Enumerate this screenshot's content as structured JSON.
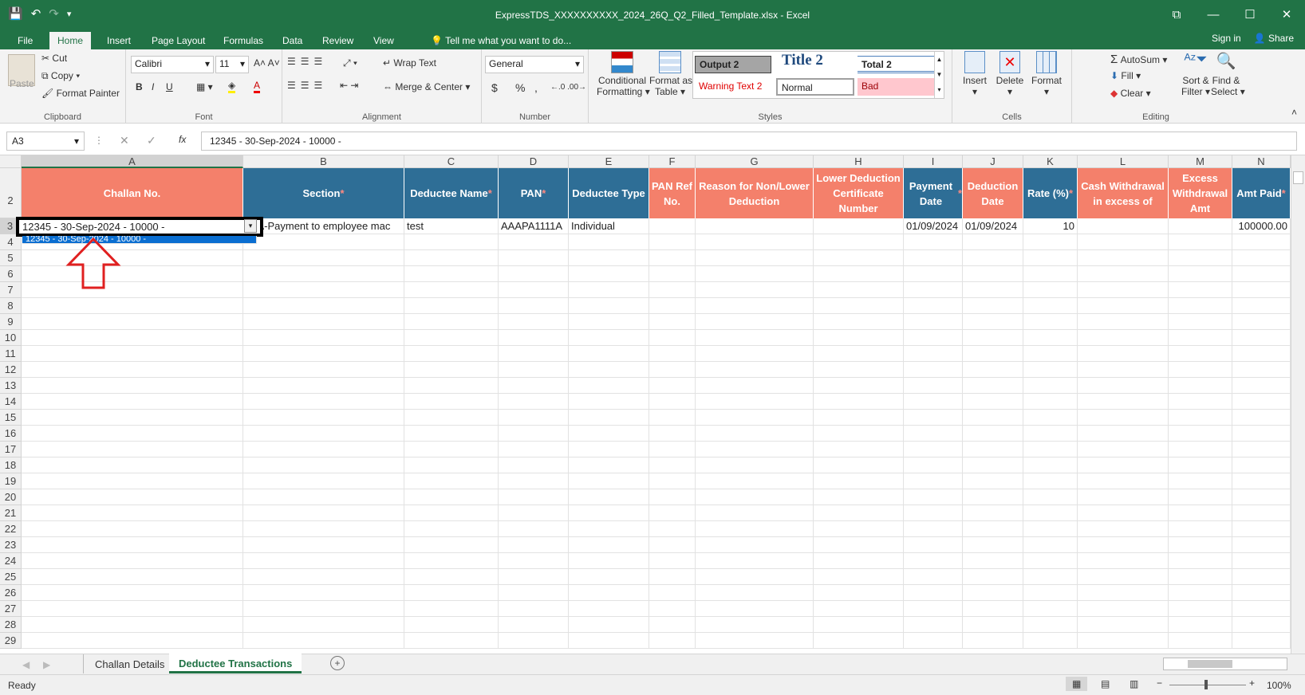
{
  "window": {
    "title": "ExpressTDS_XXXXXXXXXX_2024_26Q_Q2_Filled_Template.xlsx - Excel",
    "qat": {
      "save": "💾",
      "undo": "↶",
      "redo": "↷",
      "more": "▾"
    },
    "buttons": {
      "ribbon_display": "⧉",
      "minimize": "—",
      "maximize": "☐",
      "close": "✕"
    }
  },
  "menu": {
    "tabs": [
      "File",
      "Home",
      "Insert",
      "Page Layout",
      "Formulas",
      "Data",
      "Review",
      "View"
    ],
    "tell_me": "Tell me what you want to do...",
    "sign_in": "Sign in",
    "share": "Share"
  },
  "ribbon": {
    "clipboard": {
      "paste": "Paste",
      "cut": "Cut",
      "copy": "Copy",
      "format_painter": "Format Painter",
      "label": "Clipboard"
    },
    "font": {
      "name": "Calibri",
      "size": "11",
      "label": "Font",
      "bold": "B",
      "italic": "I",
      "underline": "U"
    },
    "alignment": {
      "wrap_text": "Wrap Text",
      "merge_center": "Merge & Center",
      "label": "Alignment"
    },
    "number": {
      "format": "General",
      "currency": "$",
      "percent": "%",
      "comma": ",",
      "label": "Number"
    },
    "styles": {
      "conditional": [
        "Conditional",
        "Formatting"
      ],
      "format_table": [
        "Format as",
        "Table"
      ],
      "output2": "Output 2",
      "title2": "Title 2",
      "total2": "Total 2",
      "warning": "Warning Text 2",
      "normal": "Normal",
      "bad": "Bad",
      "label": "Styles"
    },
    "cells": {
      "insert": "Insert",
      "delete": "Delete",
      "format": "Format",
      "label": "Cells"
    },
    "editing": {
      "autosum": "AutoSum",
      "fill": "Fill",
      "clear": "Clear",
      "sort": [
        "Sort &",
        "Filter"
      ],
      "find": [
        "Find &",
        "Select"
      ],
      "label": "Editing"
    }
  },
  "formula_bar": {
    "name_box": "A3",
    "cancel": "✕",
    "enter": "✓",
    "fx": "fx",
    "content": "12345 - 30-Sep-2024 - 10000 -"
  },
  "columns": [
    "A",
    "B",
    "C",
    "D",
    "E",
    "F",
    "G",
    "H",
    "I",
    "J",
    "K",
    "L",
    "M",
    "N"
  ],
  "headers": [
    {
      "text": "Challan No.",
      "req": false,
      "color": "#f4806b"
    },
    {
      "text": "Section",
      "req": true,
      "color": "#2e6e96"
    },
    {
      "text": "Deductee Name",
      "req": true,
      "color": "#2e6e96"
    },
    {
      "text": "PAN",
      "req": true,
      "color": "#2e6e96"
    },
    {
      "text": "Deductee Type",
      "req": false,
      "color": "#2e6e96"
    },
    {
      "text": "PAN Ref No.",
      "req": false,
      "color": "#f4806b"
    },
    {
      "text": "Reason for Non/Lower Deduction",
      "req": false,
      "color": "#f4806b"
    },
    {
      "text": "Lower Deduction Certificate Number",
      "req": false,
      "color": "#f4806b"
    },
    {
      "text": "Payment Date",
      "req": true,
      "color": "#2e6e96"
    },
    {
      "text": "Deduction Date",
      "req": false,
      "color": "#f4806b"
    },
    {
      "text": "Rate (%)",
      "req": true,
      "color": "#2e6e96"
    },
    {
      "text": "Cash Withdrawal in excess of",
      "req": false,
      "color": "#f4806b"
    },
    {
      "text": "Excess Withdrawal Amt",
      "req": false,
      "color": "#f4806b"
    },
    {
      "text": "Amt Paid",
      "req": true,
      "color": "#2e6e96"
    }
  ],
  "row3": [
    "12345 - 30-Sep-2024 - 10000 -",
    "94A-Payment to employee mac",
    "test",
    "AAAPA1111A",
    "Individual",
    "",
    "",
    "",
    "01/09/2024",
    "01/09/2024",
    "10",
    "",
    "",
    "100000.00"
  ],
  "row_numbers": [
    "2",
    "3",
    "4",
    "5",
    "6",
    "7",
    "8",
    "9",
    "10",
    "11",
    "12",
    "13",
    "14",
    "15",
    "16",
    "17",
    "18",
    "19",
    "20",
    "21",
    "22",
    "23",
    "24",
    "25",
    "26",
    "27",
    "28",
    "29"
  ],
  "dropdown": {
    "option": "12345 - 30-Sep-2024 - 10000 -"
  },
  "sheets": {
    "tabs": [
      "Challan Details",
      "Deductee Transactions"
    ],
    "add": "+"
  },
  "status": {
    "ready": "Ready",
    "zoom": "100%"
  },
  "colors": {
    "excel_green": "#217346",
    "header_blue": "#2e6e96",
    "header_salmon": "#f4806b",
    "arrow_red": "#e02020"
  }
}
